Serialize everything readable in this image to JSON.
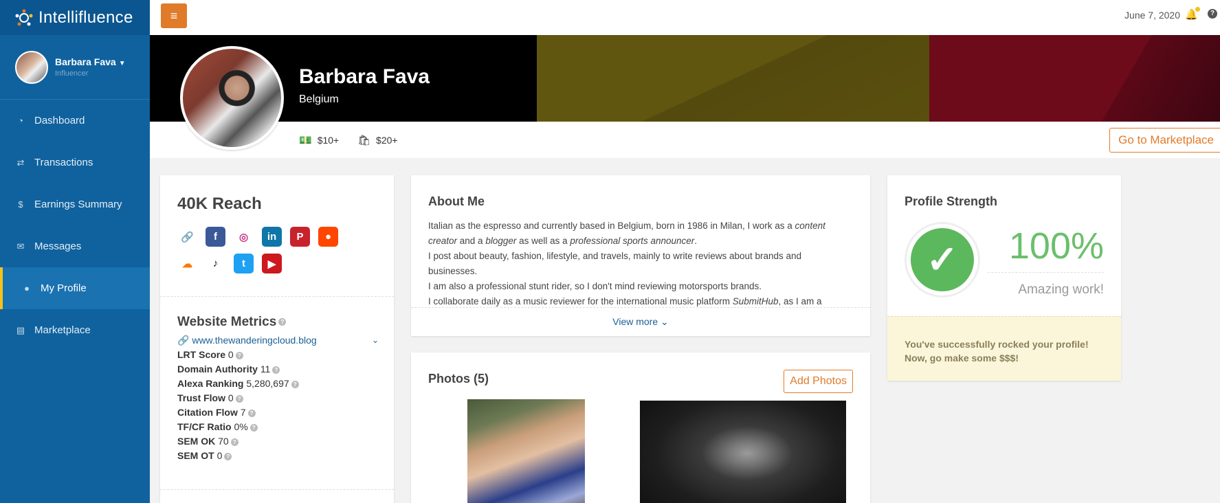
{
  "brand": {
    "prefix": "Intelli",
    "suffix": "fluence"
  },
  "user": {
    "name": "Barbara Fava",
    "role": "Influencer"
  },
  "nav": [
    {
      "label": "Dashboard",
      "icon": "dashboard-icon",
      "glyph": "◔"
    },
    {
      "label": "Transactions",
      "icon": "exchange-icon",
      "glyph": "⇄"
    },
    {
      "label": "Earnings Summary",
      "icon": "dollar-icon",
      "glyph": "$"
    },
    {
      "label": "Messages",
      "icon": "chat-icon",
      "glyph": "✉"
    },
    {
      "label": "My Profile",
      "icon": "user-icon",
      "glyph": "●",
      "active": true
    },
    {
      "label": "Marketplace",
      "icon": "list-icon",
      "glyph": "▤"
    }
  ],
  "topbar": {
    "date": "June 7, 2020",
    "help": "?"
  },
  "profile": {
    "name": "Barbara Fava",
    "country": "Belgium",
    "price_post": "$10+",
    "price_product": "$20+",
    "go_marketplace": "Go to Marketplace"
  },
  "reach": {
    "title": "40K Reach",
    "socials": [
      {
        "icon": "link-icon",
        "color": "#ffffff",
        "fg": "#4aa37a",
        "glyph": "🔗"
      },
      {
        "icon": "facebook-icon",
        "color": "#3b5998",
        "fg": "#ffffff",
        "glyph": "f"
      },
      {
        "icon": "instagram-icon",
        "color": "#ffffff",
        "fg": "#c13584",
        "glyph": "◎"
      },
      {
        "icon": "linkedin-icon",
        "color": "#0e76a8",
        "fg": "#ffffff",
        "glyph": "in"
      },
      {
        "icon": "pinterest-icon",
        "color": "#c8232c",
        "fg": "#ffffff",
        "glyph": "P"
      },
      {
        "icon": "reddit-icon",
        "color": "#ff4500",
        "fg": "#ffffff",
        "glyph": "●"
      },
      {
        "icon": "soundcloud-icon",
        "color": "#ffffff",
        "fg": "#ff7700",
        "glyph": "☁"
      },
      {
        "icon": "tiktok-icon",
        "color": "#ffffff",
        "fg": "#111111",
        "glyph": "♪"
      },
      {
        "icon": "twitter-icon",
        "color": "#1da1f2",
        "fg": "#ffffff",
        "glyph": "t"
      },
      {
        "icon": "youtube-icon",
        "color": "#cc181e",
        "fg": "#ffffff",
        "glyph": "▶"
      }
    ]
  },
  "metrics": {
    "title": "Website Metrics",
    "site": "www.thewanderingcloud.blog",
    "items": [
      {
        "label": "LRT Score",
        "value": "0"
      },
      {
        "label": "Domain Authority",
        "value": "11"
      },
      {
        "label": "Alexa Ranking",
        "value": "5,280,697"
      },
      {
        "label": "Trust Flow",
        "value": "0"
      },
      {
        "label": "Citation Flow",
        "value": "7"
      },
      {
        "label": "TF/CF Ratio",
        "value": "0%"
      },
      {
        "label": "SEM OK",
        "value": "70"
      },
      {
        "label": "SEM OT",
        "value": "0"
      }
    ]
  },
  "about": {
    "title": "About Me",
    "p1a": "Italian as the espresso and currently based in Belgium, born in 1986 in Milan, I work as a ",
    "p1b": "content creator",
    "p1c": " and a ",
    "p1d": "blogger",
    "p1e": " as well as a ",
    "p1f": "professional sports announcer",
    "p1g": ".",
    "p2": "I post about beauty, fashion, lifestyle, and travels, mainly to write reviews about brands and businesses.",
    "p3": "I am also a professional stunt rider, so I don't mind reviewing motorsports brands.",
    "p4a": "I collaborate daily as a music reviewer for the international music platform ",
    "p4b": "SubmitHub",
    "p4c": ", as I am a",
    "view_more": "View more ⌄"
  },
  "photos": {
    "title": "Photos (5)",
    "add_label": "Add Photos"
  },
  "strength": {
    "title": "Profile Strength",
    "percent": "100%",
    "caption": "Amazing work!",
    "note_line1": "You've successfully rocked your profile!",
    "note_line2": "Now, go make some $$$!"
  }
}
